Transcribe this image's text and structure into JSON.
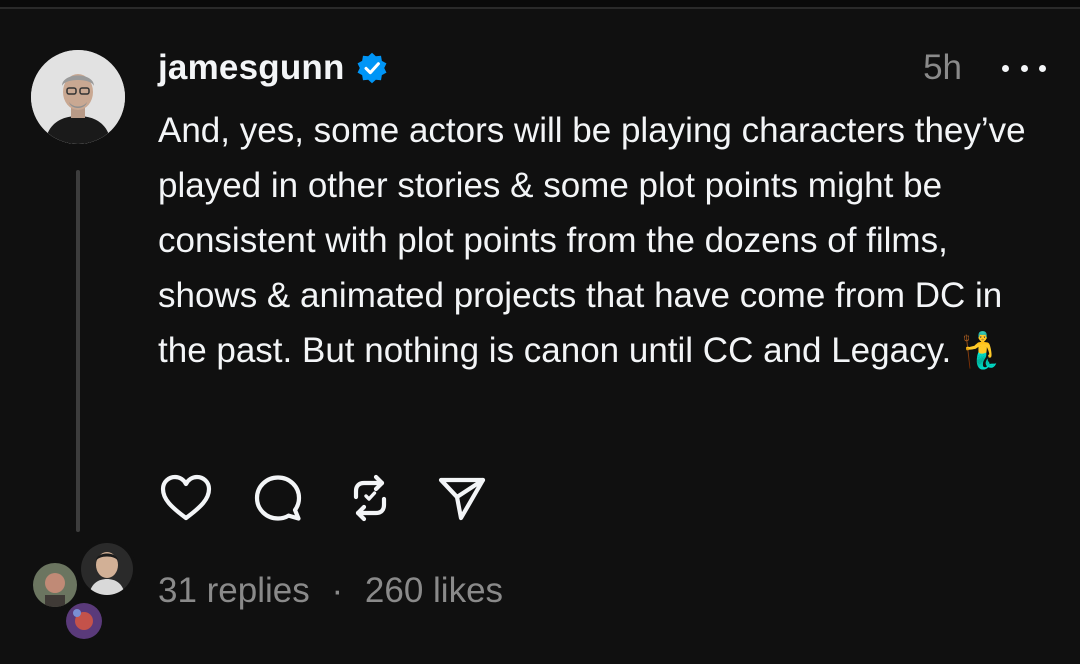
{
  "post": {
    "author": {
      "username": "jamesgunn",
      "verified": true,
      "verified_icon": "verified-badge-icon",
      "avatar_icon": "profile-photo"
    },
    "time_ago": "5h",
    "text": "And, yes, some actors will be playing characters they’ve played in other stories & some plot points might be consistent with plot points from the dozens of films, shows & animated projects that have come from DC in the past. But nothing is canon until CC and Legacy. 🧜‍♂️",
    "actions": [
      {
        "name": "like",
        "icon": "heart-icon"
      },
      {
        "name": "reply",
        "icon": "comment-bubble-icon"
      },
      {
        "name": "repost",
        "icon": "repost-icon"
      },
      {
        "name": "share",
        "icon": "send-icon"
      }
    ],
    "replies_label": "31 replies",
    "separator": "·",
    "likes_label": "260 likes"
  },
  "colors": {
    "background": "#101010",
    "text": "#f3f5f7",
    "muted": "#8a8a8a",
    "verified": "#0095f6",
    "thread_line": "#3d3d3d"
  }
}
